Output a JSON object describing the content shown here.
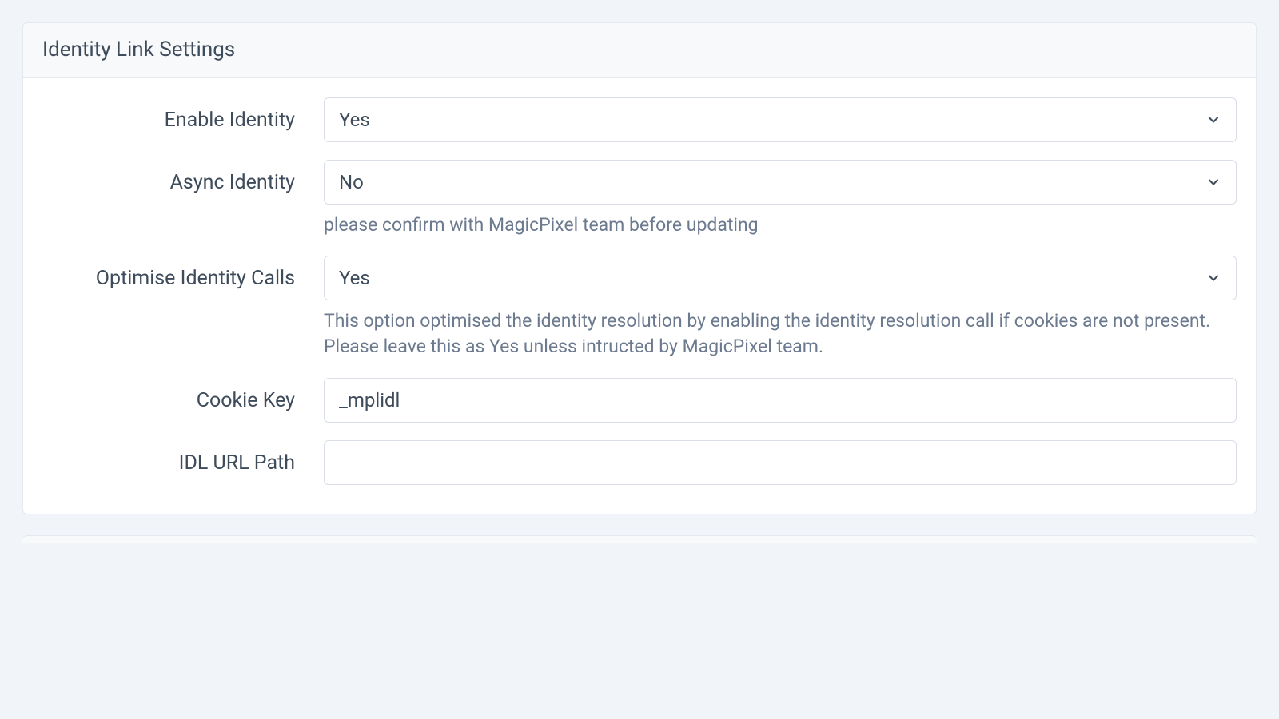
{
  "panel": {
    "title": "Identity Link Settings"
  },
  "fields": {
    "enable_identity": {
      "label": "Enable Identity",
      "value": "Yes"
    },
    "async_identity": {
      "label": "Async Identity",
      "value": "No",
      "help": "please confirm with MagicPixel team before updating"
    },
    "optimise_identity_calls": {
      "label": "Optimise Identity Calls",
      "value": "Yes",
      "help": "This option optimised the identity resolution by enabling the identity resolution call if cookies are not present. Please leave this as Yes unless intructed by MagicPixel team."
    },
    "cookie_key": {
      "label": "Cookie Key",
      "value": "_mplidl"
    },
    "idl_url_path": {
      "label": "IDL URL Path",
      "value": ""
    }
  }
}
